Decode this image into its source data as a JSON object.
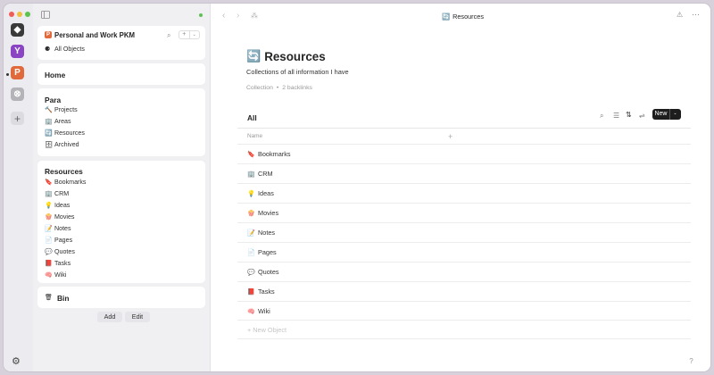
{
  "window": {
    "title": "Resources",
    "title_icon": "🔄"
  },
  "spaces": [
    {
      "name": "cube-space-icon",
      "glyph": "◆",
      "color": "#3a3a3a"
    },
    {
      "name": "y-space-icon",
      "glyph": "Y",
      "color": "#8a44c4"
    },
    {
      "name": "p-space-icon",
      "glyph": "P",
      "color": "#e06a3c"
    },
    {
      "name": "globe-space-icon",
      "glyph": "⊗",
      "color": "#b3b3b8"
    }
  ],
  "sidebar": {
    "space_name": "Personal and Work PKM",
    "space_badge": "P",
    "all_objects": "All Objects",
    "all_objects_icon": "⚈",
    "home": "Home",
    "para": {
      "title": "Para",
      "items": [
        {
          "icon": "🔨",
          "label": "Projects"
        },
        {
          "icon": "🏢",
          "label": "Areas"
        },
        {
          "icon": "🔄",
          "label": "Resources"
        },
        {
          "icon": "🗄",
          "label": "Archived"
        }
      ]
    },
    "resources": {
      "title": "Resources",
      "items": [
        {
          "icon": "🔖",
          "label": "Bookmarks"
        },
        {
          "icon": "🏢",
          "label": "CRM"
        },
        {
          "icon": "💡",
          "label": "Ideas"
        },
        {
          "icon": "🍿",
          "label": "Movies"
        },
        {
          "icon": "📝",
          "label": "Notes"
        },
        {
          "icon": "📄",
          "label": "Pages"
        },
        {
          "icon": "💬",
          "label": "Quotes"
        },
        {
          "icon": "📕",
          "label": "Tasks"
        },
        {
          "icon": "🧠",
          "label": "Wiki"
        }
      ]
    },
    "bin": {
      "icon": "🗑",
      "label": "Bin"
    },
    "add_label": "Add",
    "edit_label": "Edit"
  },
  "page": {
    "icon": "🔄",
    "title": "Resources",
    "description": "Collections of all information I have",
    "type": "Collection",
    "separator": "•",
    "backlinks": "2 backlinks",
    "view_title": "All",
    "new_label": "New",
    "column_name": "Name",
    "add_column": "+",
    "rows": [
      {
        "icon": "🔖",
        "label": "Bookmarks"
      },
      {
        "icon": "🏢",
        "label": "CRM"
      },
      {
        "icon": "💡",
        "label": "Ideas"
      },
      {
        "icon": "🍿",
        "label": "Movies"
      },
      {
        "icon": "📝",
        "label": "Notes"
      },
      {
        "icon": "📄",
        "label": "Pages"
      },
      {
        "icon": "💬",
        "label": "Quotes"
      },
      {
        "icon": "📕",
        "label": "Tasks"
      },
      {
        "icon": "🧠",
        "label": "Wiki"
      }
    ],
    "new_object": "+ New Object"
  },
  "help": "?"
}
